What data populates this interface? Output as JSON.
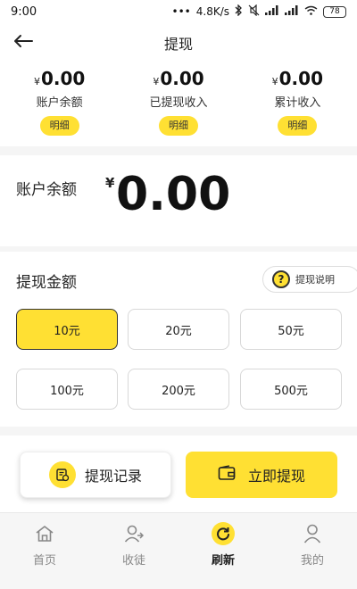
{
  "status_bar": {
    "time": "9:00",
    "dots": "•••",
    "speed": "4.8K/s",
    "battery": "78"
  },
  "nav": {
    "title": "提现"
  },
  "summary": [
    {
      "currency": "¥",
      "amount": "0.00",
      "label": "账户余额",
      "detail": "明细"
    },
    {
      "currency": "¥",
      "amount": "0.00",
      "label": "已提现收入",
      "detail": "明细"
    },
    {
      "currency": "¥",
      "amount": "0.00",
      "label": "累计收入",
      "detail": "明细"
    }
  ],
  "balance": {
    "label": "账户余额",
    "currency": "¥",
    "amount": "0.00"
  },
  "amount_section": {
    "title": "提现金额",
    "explain_label": "提现说明",
    "options": [
      "10元",
      "20元",
      "50元",
      "100元",
      "200元",
      "500元"
    ],
    "selected_index": 0
  },
  "actions": {
    "record_label": "提现记录",
    "withdraw_label": "立即提现"
  },
  "tabs": [
    {
      "label": "首页",
      "icon": "home-icon"
    },
    {
      "label": "收徒",
      "icon": "add-user-icon"
    },
    {
      "label": "刷新",
      "icon": "refresh-icon",
      "active": true
    },
    {
      "label": "我的",
      "icon": "profile-icon"
    }
  ],
  "colors": {
    "accent": "#ffe033",
    "text": "#222222",
    "muted": "#888888"
  }
}
